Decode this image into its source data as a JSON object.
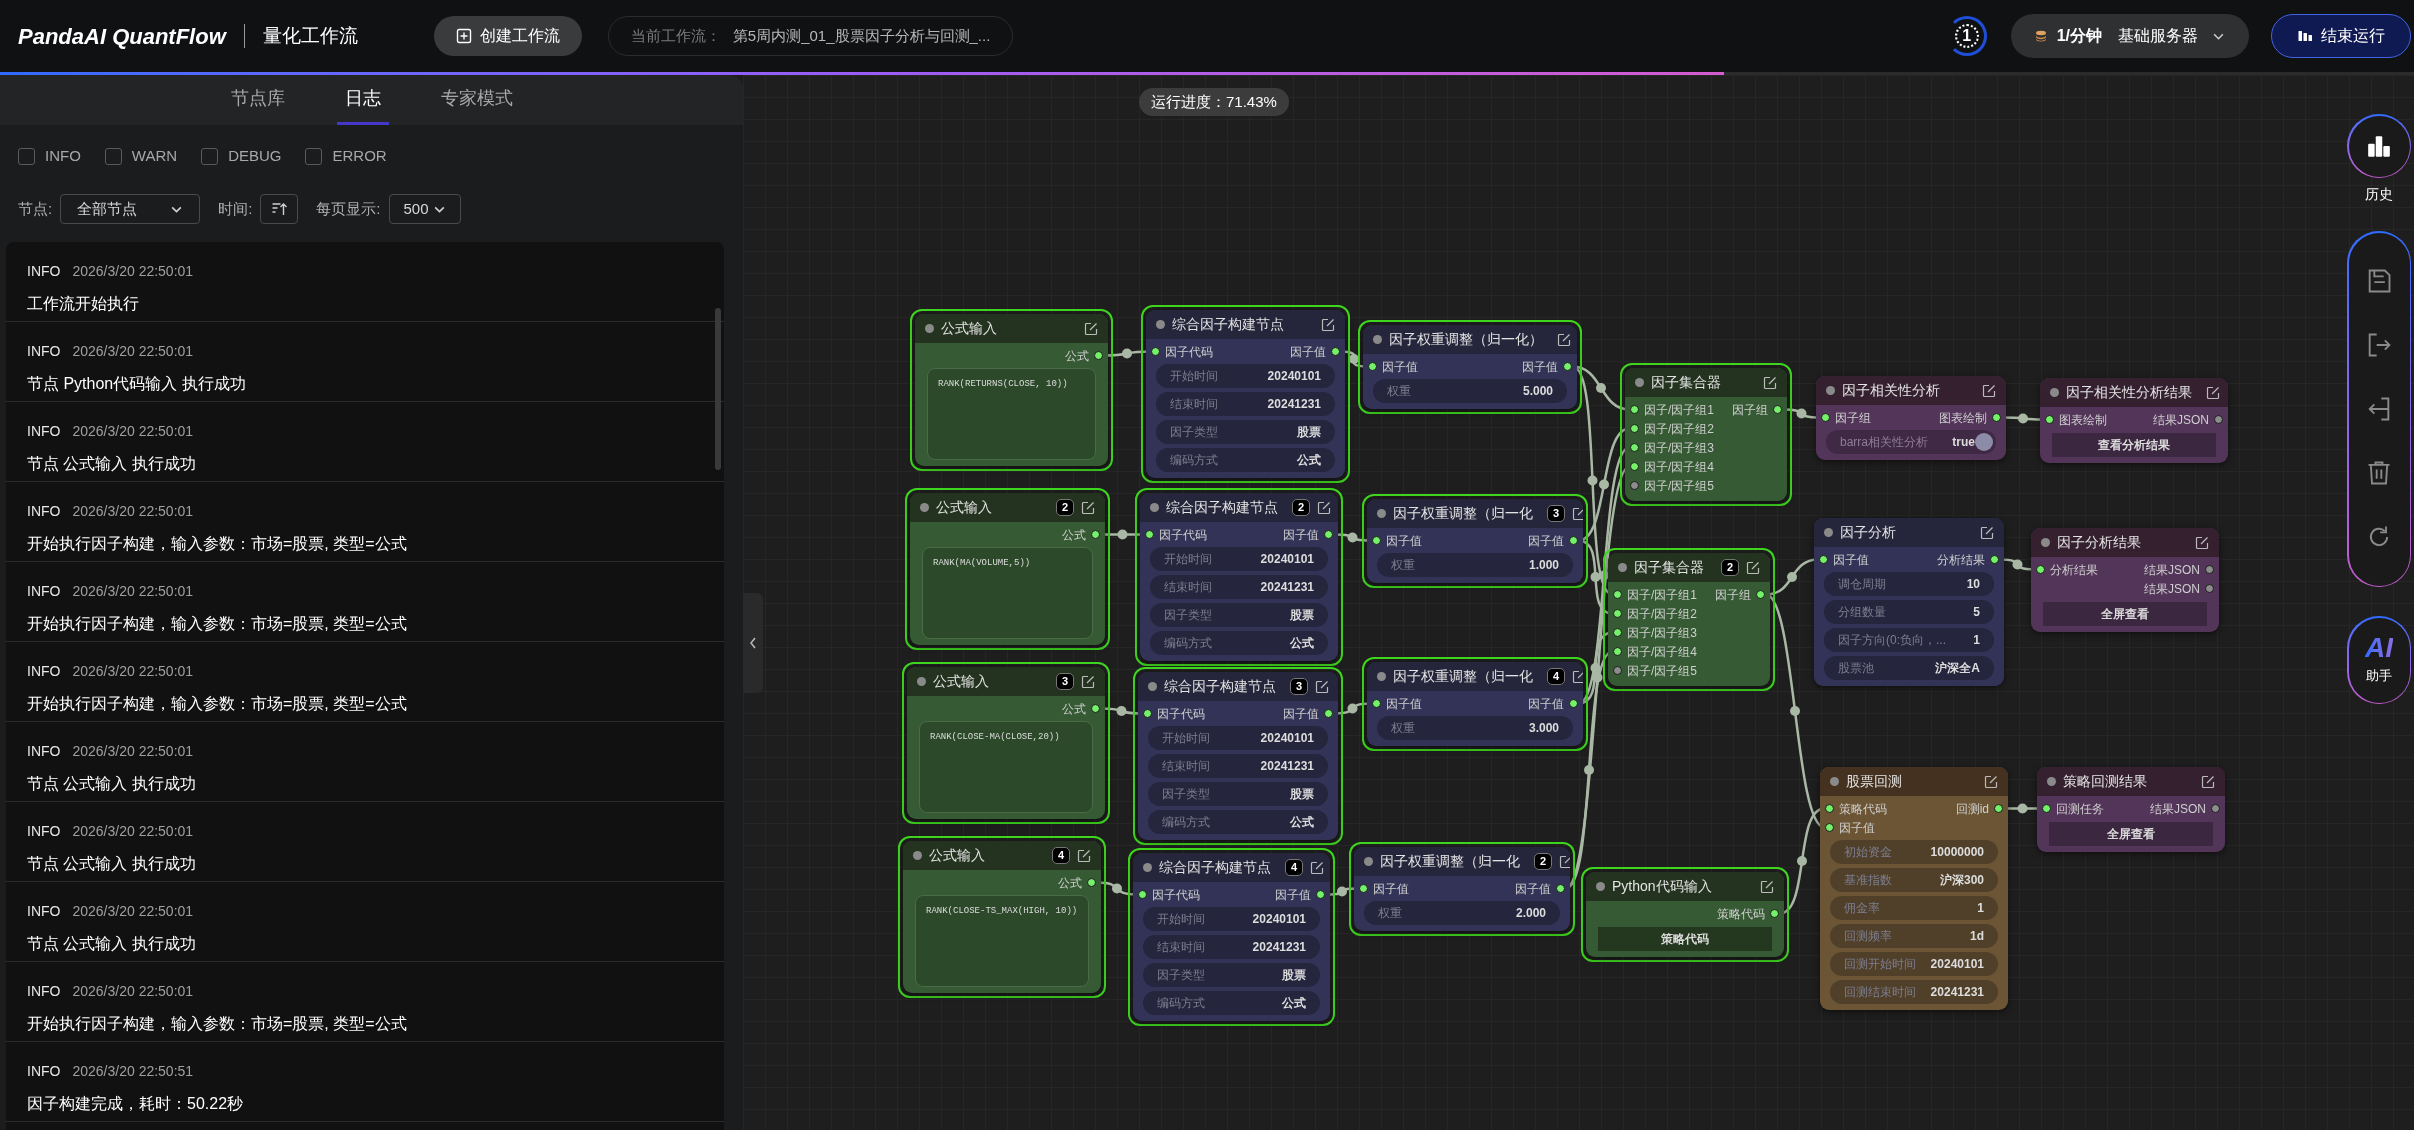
{
  "header": {
    "logo": "PandaAI QuantFlow",
    "title": "量化工作流",
    "create_button": "创建工作流",
    "current_workflow": {
      "label": "当前工作流：",
      "value": "第5周内测_01_股票因子分析与回测_..."
    },
    "run_counter": "1",
    "server": {
      "rate": "1/分钟",
      "name": "基础服务器"
    },
    "stop_button": "结束运行"
  },
  "progress": {
    "text": "运行进度：71.43%",
    "level": 0.7143
  },
  "panel": {
    "tabs": [
      {
        "label": "节点库",
        "selected": false
      },
      {
        "label": "日志",
        "selected": true
      },
      {
        "label": "专家模式",
        "selected": false
      }
    ],
    "levels": [
      {
        "label": "INFO",
        "checked": false
      },
      {
        "label": "WARN",
        "checked": false
      },
      {
        "label": "DEBUG",
        "checked": false
      },
      {
        "label": "ERROR",
        "checked": false
      }
    ],
    "filters": {
      "node_label": "节点:",
      "node_value": "全部节点",
      "time_label": "时间:",
      "page_label": "每页显示:",
      "page_value": "500"
    },
    "logs": [
      {
        "level": "INFO",
        "time": "2026/3/20 22:50:01",
        "message": "工作流开始执行"
      },
      {
        "level": "INFO",
        "time": "2026/3/20 22:50:01",
        "message": "节点 Python代码输入 执行成功"
      },
      {
        "level": "INFO",
        "time": "2026/3/20 22:50:01",
        "message": "节点 公式输入 执行成功"
      },
      {
        "level": "INFO",
        "time": "2026/3/20 22:50:01",
        "message": "开始执行因子构建，输入参数：市场=股票, 类型=公式"
      },
      {
        "level": "INFO",
        "time": "2026/3/20 22:50:01",
        "message": "开始执行因子构建，输入参数：市场=股票, 类型=公式"
      },
      {
        "level": "INFO",
        "time": "2026/3/20 22:50:01",
        "message": "开始执行因子构建，输入参数：市场=股票, 类型=公式"
      },
      {
        "level": "INFO",
        "time": "2026/3/20 22:50:01",
        "message": "节点 公式输入 执行成功"
      },
      {
        "level": "INFO",
        "time": "2026/3/20 22:50:01",
        "message": "节点 公式输入 执行成功"
      },
      {
        "level": "INFO",
        "time": "2026/3/20 22:50:01",
        "message": "节点 公式输入 执行成功"
      },
      {
        "level": "INFO",
        "time": "2026/3/20 22:50:01",
        "message": "开始执行因子构建，输入参数：市场=股票, 类型=公式"
      },
      {
        "level": "INFO",
        "time": "2026/3/20 22:50:51",
        "message": "因子构建完成，耗时：50.22秒"
      }
    ]
  },
  "nodes": [
    {
      "kind": "formula",
      "title": "公式输入",
      "executed": true,
      "ports": [
        {
          "output": {
            "label": "公式",
            "connected": true
          }
        }
      ],
      "formula": "RANK(RETURNS(CLOSE, 10))"
    },
    {
      "kind": "formula",
      "title": "公式输入",
      "badge": "2",
      "executed": true,
      "ports": [
        {
          "output": {
            "label": "公式",
            "connected": true
          }
        }
      ],
      "formula": "RANK(MA(VOLUME,5))"
    },
    {
      "kind": "formula",
      "title": "公式输入",
      "badge": "3",
      "executed": true,
      "ports": [
        {
          "output": {
            "label": "公式",
            "connected": true
          }
        }
      ],
      "formula": "RANK(CLOSE-MA(CLOSE,20))"
    },
    {
      "kind": "formula",
      "title": "公式输入",
      "badge": "4",
      "executed": true,
      "ports": [
        {
          "output": {
            "label": "公式",
            "connected": true
          }
        }
      ],
      "formula": "RANK(CLOSE-TS_MAX(HIGH, 10))"
    },
    {
      "kind": "factor",
      "title": "综合因子构建节点",
      "executed": true,
      "ports": [
        {
          "input": {
            "label": "因子代码",
            "connected": true
          },
          "output": {
            "label": "因子值",
            "connected": true
          }
        }
      ],
      "params": [
        {
          "label": "开始时间",
          "value": "20240101"
        },
        {
          "label": "结束时间",
          "value": "20241231"
        },
        {
          "label": "因子类型",
          "value": "股票"
        },
        {
          "label": "编码方式",
          "value": "公式"
        }
      ]
    },
    {
      "kind": "factor",
      "title": "综合因子构建节点",
      "badge": "2",
      "executed": true,
      "ports": [
        {
          "input": {
            "label": "因子代码",
            "connected": true
          },
          "output": {
            "label": "因子值",
            "connected": true
          }
        }
      ],
      "params": [
        {
          "label": "开始时间",
          "value": "20240101"
        },
        {
          "label": "结束时间",
          "value": "20241231"
        },
        {
          "label": "因子类型",
          "value": "股票"
        },
        {
          "label": "编码方式",
          "value": "公式"
        }
      ]
    },
    {
      "kind": "factor",
      "title": "综合因子构建节点",
      "badge": "3",
      "executed": true,
      "ports": [
        {
          "input": {
            "label": "因子代码",
            "connected": true
          },
          "output": {
            "label": "因子值",
            "connected": true
          }
        }
      ],
      "params": [
        {
          "label": "开始时间",
          "value": "20240101"
        },
        {
          "label": "结束时间",
          "value": "20241231"
        },
        {
          "label": "因子类型",
          "value": "股票"
        },
        {
          "label": "编码方式",
          "value": "公式"
        }
      ]
    },
    {
      "kind": "factor",
      "title": "综合因子构建节点",
      "badge": "4",
      "executed": true,
      "ports": [
        {
          "input": {
            "label": "因子代码",
            "connected": true
          },
          "output": {
            "label": "因子值",
            "connected": true
          }
        }
      ],
      "params": [
        {
          "label": "开始时间",
          "value": "20240101"
        },
        {
          "label": "结束时间",
          "value": "20241231"
        },
        {
          "label": "因子类型",
          "value": "股票"
        },
        {
          "label": "编码方式",
          "value": "公式"
        }
      ]
    },
    {
      "kind": "weight",
      "title": "因子权重调整（归一化）",
      "executed": true,
      "ports": [
        {
          "input": {
            "label": "因子值",
            "connected": true
          },
          "output": {
            "label": "因子值",
            "connected": true
          }
        }
      ],
      "params": [
        {
          "label": "权重",
          "value": "5.000"
        }
      ]
    },
    {
      "kind": "weight",
      "title": "因子权重调整（归一化",
      "badge": "3",
      "executed": true,
      "ports": [
        {
          "input": {
            "label": "因子值",
            "connected": true
          },
          "output": {
            "label": "因子值",
            "connected": true
          }
        }
      ],
      "params": [
        {
          "label": "权重",
          "value": "1.000"
        }
      ]
    },
    {
      "kind": "weight",
      "title": "因子权重调整（归一化",
      "badge": "4",
      "executed": true,
      "ports": [
        {
          "input": {
            "label": "因子值",
            "connected": true
          },
          "output": {
            "label": "因子值",
            "connected": true
          }
        }
      ],
      "params": [
        {
          "label": "权重",
          "value": "3.000"
        }
      ]
    },
    {
      "kind": "weight",
      "title": "因子权重调整（归一化",
      "badge": "2",
      "executed": true,
      "ports": [
        {
          "input": {
            "label": "因子值",
            "connected": true
          },
          "output": {
            "label": "因子值",
            "connected": true
          }
        }
      ],
      "params": [
        {
          "label": "权重",
          "value": "2.000"
        }
      ]
    },
    {
      "kind": "aggregator",
      "title": "因子集合器",
      "executed": true,
      "ports": [
        {
          "input": {
            "label": "因子/因子组1",
            "connected": true
          },
          "output": {
            "label": "因子组",
            "connected": true
          }
        },
        {
          "input": {
            "label": "因子/因子组2",
            "connected": true
          }
        },
        {
          "input": {
            "label": "因子/因子组3",
            "connected": true
          }
        },
        {
          "input": {
            "label": "因子/因子组4",
            "connected": true
          }
        },
        {
          "input": {
            "label": "因子/因子组5",
            "connected": false
          }
        }
      ]
    },
    {
      "kind": "aggregator",
      "title": "因子集合器",
      "badge": "2",
      "executed": true,
      "ports": [
        {
          "input": {
            "label": "因子/因子组1",
            "connected": true
          },
          "output": {
            "label": "因子组",
            "connected": true
          }
        },
        {
          "input": {
            "label": "因子/因子组2",
            "connected": true
          }
        },
        {
          "input": {
            "label": "因子/因子组3",
            "connected": true
          }
        },
        {
          "input": {
            "label": "因子/因子组4",
            "connected": true
          }
        },
        {
          "input": {
            "label": "因子/因子组5",
            "connected": false
          }
        }
      ]
    },
    {
      "kind": "python",
      "title": "Python代码输入",
      "executed": true,
      "ports": [
        {
          "output": {
            "label": "策略代码",
            "connected": true
          }
        }
      ],
      "action": "策略代码"
    },
    {
      "kind": "correlation",
      "title": "因子相关性分析",
      "executed": false,
      "ports": [
        {
          "input": {
            "label": "因子组",
            "connected": true
          },
          "output": {
            "label": "图表绘制",
            "connected": true
          }
        }
      ],
      "params": [
        {
          "kind": "toggle",
          "label": "barra相关性分析",
          "value": "true",
          "on": true
        }
      ]
    },
    {
      "kind": "result",
      "title": "因子相关性分析结果",
      "executed": false,
      "ports": [
        {
          "input": {
            "label": "图表绘制",
            "connected": true
          },
          "output": {
            "label": "结果JSON",
            "connected": false
          }
        }
      ],
      "action": "查看分析结果"
    },
    {
      "kind": "analysis",
      "title": "因子分析",
      "executed": false,
      "ports": [
        {
          "input": {
            "label": "因子值",
            "connected": true
          },
          "output": {
            "label": "分析结果",
            "connected": true
          }
        }
      ],
      "params": [
        {
          "label": "调仓周期",
          "value": "10"
        },
        {
          "label": "分组数量",
          "value": "5"
        },
        {
          "label": "因子方向(0:负向，...",
          "value": "1"
        },
        {
          "label": "股票池",
          "value": "沪深全A"
        }
      ]
    },
    {
      "kind": "result",
      "title": "因子分析结果",
      "executed": false,
      "ports": [
        {
          "input": {
            "label": "分析结果",
            "connected": true
          },
          "output": {
            "label": "结果JSON",
            "connected": false
          }
        },
        {
          "output": {
            "label": "结果JSON",
            "connected": false
          }
        }
      ],
      "action": "全屏查看"
    },
    {
      "kind": "backtest",
      "title": "股票回测",
      "executed": false,
      "ports": [
        {
          "input": {
            "label": "策略代码",
            "connected": true
          },
          "output": {
            "label": "回测id",
            "connected": true
          }
        },
        {
          "input": {
            "label": "因子值",
            "connected": true
          }
        }
      ],
      "params": [
        {
          "label": "初始资金",
          "value": "10000000"
        },
        {
          "label": "基准指数",
          "value": "沪深300"
        },
        {
          "label": "佣金率",
          "value": "1"
        },
        {
          "label": "回测频率",
          "value": "1d"
        },
        {
          "label": "回测开始时间",
          "value": "20240101"
        },
        {
          "label": "回测结束时间",
          "value": "20241231"
        }
      ]
    },
    {
      "kind": "result",
      "title": "策略回测结果",
      "executed": false,
      "ports": [
        {
          "input": {
            "label": "回测任务",
            "connected": true
          },
          "output": {
            "label": "结果JSON",
            "connected": false
          }
        }
      ],
      "action": "全屏查看"
    }
  ],
  "sidebar": {
    "history": "历史",
    "ai": {
      "logo": "AI",
      "label": "助手"
    }
  }
}
